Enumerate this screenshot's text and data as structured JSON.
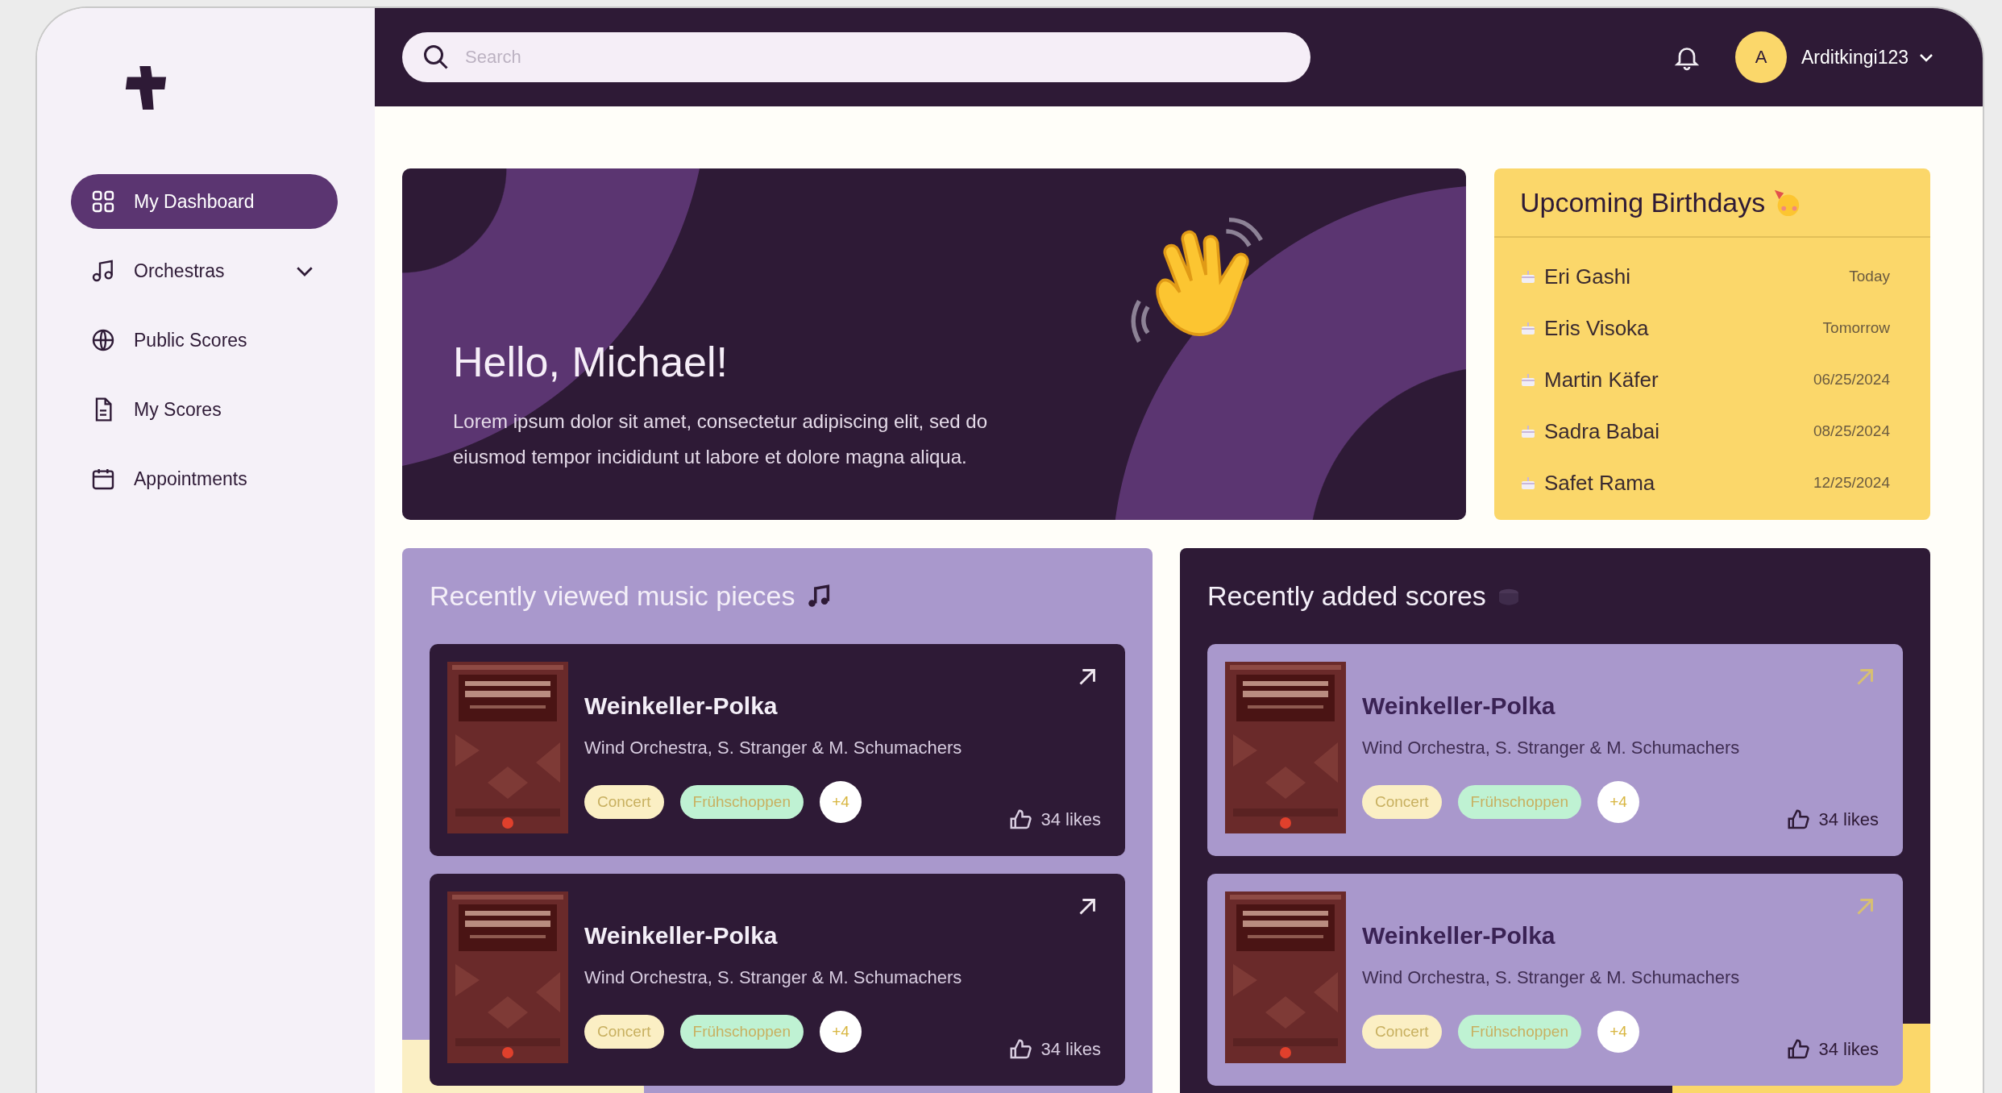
{
  "sidebar": {
    "items": [
      {
        "label": "My Dashboard",
        "selected": true,
        "kind": "link"
      },
      {
        "label": "Orchestras",
        "selected": false,
        "kind": "group",
        "expanded": false
      },
      {
        "label": "Public Scores",
        "selected": false,
        "kind": "link"
      },
      {
        "label": "My Scores",
        "selected": false,
        "kind": "link"
      },
      {
        "label": "Appointments",
        "selected": false,
        "kind": "link"
      }
    ]
  },
  "topbar": {
    "search": {
      "placeholder": "Search"
    },
    "user": {
      "initial": "A",
      "name": "Arditkingi123"
    }
  },
  "hero": {
    "title": "Hello, Michael!",
    "text": "Lorem ipsum dolor sit amet, consectetur adipiscing elit, sed do eiusmod tempor incididunt ut labore et dolore magna aliqua."
  },
  "birthdays": {
    "title": "Upcoming Birthdays",
    "people": [
      {
        "name": "Eri Gashi",
        "date": "Today"
      },
      {
        "name": "Eris Visoka",
        "date": "Tomorrow"
      },
      {
        "name": "Martin Käfer",
        "date": "06/25/2024"
      },
      {
        "name": "Sadra Babai",
        "date": "08/25/2024"
      },
      {
        "name": "Safet Rama",
        "date": "12/25/2024"
      }
    ]
  },
  "panels": [
    {
      "kind": "light",
      "title": "Recently viewed music pieces",
      "items": [
        {
          "title": "Weinkeller-Polka",
          "subtitle": "Wind Orchestra, S. Stranger & M. Schumachers",
          "tags": [
            {
              "label": "Concert",
              "color": "#fbefc4"
            },
            {
              "label": "Frühschoppen",
              "color": "#bff2d3"
            }
          ],
          "more": "+4",
          "likes": "34 likes"
        },
        {
          "title": "Weinkeller-Polka",
          "subtitle": "Wind Orchestra, S. Stranger & M. Schumachers",
          "tags": [
            {
              "label": "Concert",
              "color": "#fbefc4"
            },
            {
              "label": "Frühschoppen",
              "color": "#bff2d3"
            }
          ],
          "more": "+4",
          "likes": "34 likes"
        }
      ]
    },
    {
      "kind": "dark",
      "title": "Recently added scores",
      "items": [
        {
          "title": "Weinkeller-Polka",
          "subtitle": "Wind Orchestra, S. Stranger & M. Schumachers",
          "tags": [
            {
              "label": "Concert",
              "color": "#fbefc4"
            },
            {
              "label": "Frühschoppen",
              "color": "#bff2d3"
            }
          ],
          "more": "+4",
          "likes": "34 likes"
        },
        {
          "title": "Weinkeller-Polka",
          "subtitle": "Wind Orchestra, S. Stranger & M. Schumachers",
          "tags": [
            {
              "label": "Concert",
              "color": "#fbefc4"
            },
            {
              "label": "Frühschoppen",
              "color": "#bff2d3"
            }
          ],
          "more": "+4",
          "likes": "34 likes"
        }
      ]
    }
  ]
}
